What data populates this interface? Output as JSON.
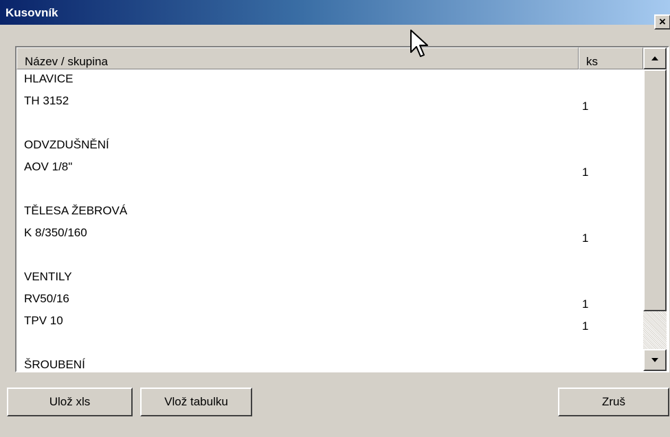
{
  "window": {
    "title": "Kusovník",
    "close_glyph": "×"
  },
  "table": {
    "columns": [
      "Název / skupina",
      "ks"
    ],
    "rows": [
      {
        "name": "HLAVICE",
        "ks": ""
      },
      {
        "name": "TH 3152",
        "ks": "1"
      },
      {
        "name": "",
        "ks": ""
      },
      {
        "name": "ODVZDUŠNĚNÍ",
        "ks": ""
      },
      {
        "name": "AOV 1/8\"",
        "ks": "1"
      },
      {
        "name": "",
        "ks": ""
      },
      {
        "name": "TĚLESA ŽEBROVÁ",
        "ks": ""
      },
      {
        "name": "K 8/350/160",
        "ks": "1"
      },
      {
        "name": "",
        "ks": ""
      },
      {
        "name": "VENTILY",
        "ks": ""
      },
      {
        "name": "RV50/16",
        "ks": "1"
      },
      {
        "name": "TPV 10",
        "ks": "1"
      },
      {
        "name": "",
        "ks": ""
      },
      {
        "name": "ŠROUBENÍ",
        "ks": ""
      }
    ]
  },
  "scrollbar": {
    "up_icon": "arrow-up-icon",
    "down_icon": "arrow-down-icon"
  },
  "buttons": {
    "save": "Ulož xls",
    "insert": "Vlož tabulku",
    "cancel": "Zruš"
  },
  "colors": {
    "title_start": "#0a246a",
    "title_end": "#a6caf0",
    "face": "#d4d0c8"
  }
}
